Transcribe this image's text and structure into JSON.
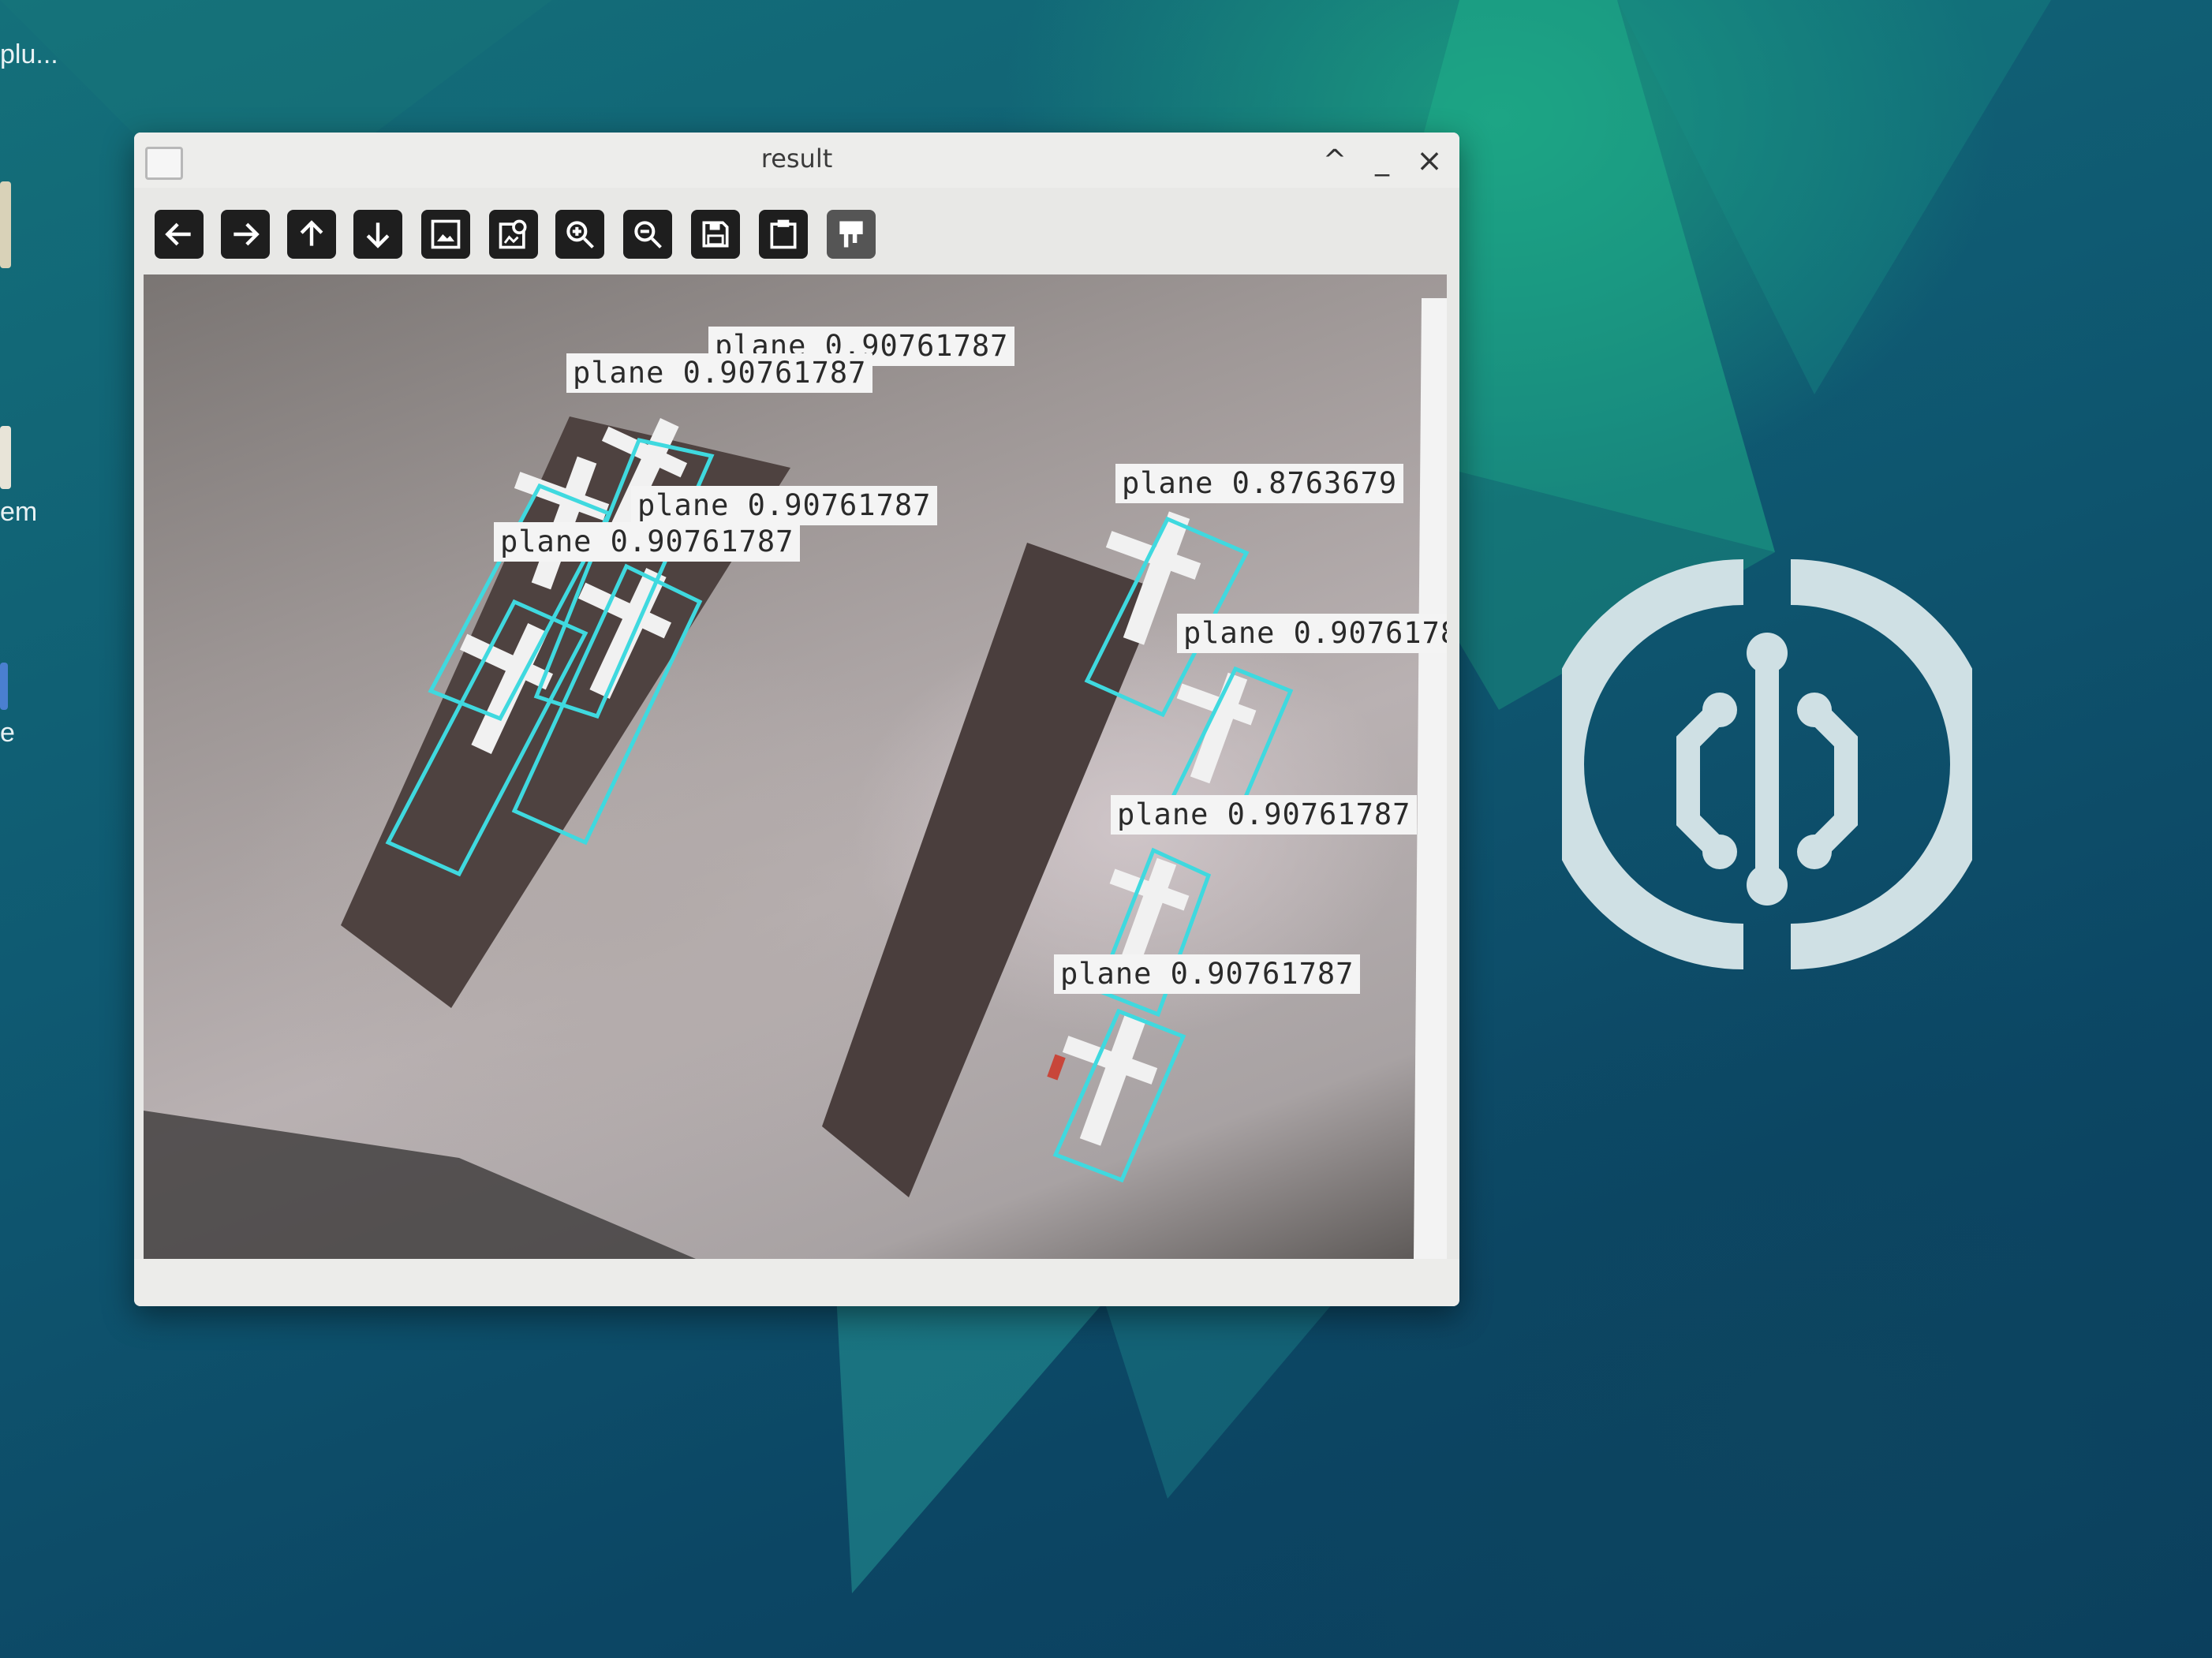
{
  "desktop": {
    "icons": [
      {
        "label": "plu..."
      },
      {
        "label": ""
      },
      {
        "label": "em"
      },
      {
        "label": "e"
      }
    ]
  },
  "window": {
    "title": "result",
    "controls": {
      "maximize": "^",
      "minimize": "_",
      "close": "×"
    },
    "toolbar": [
      {
        "name": "back-arrow-icon"
      },
      {
        "name": "forward-arrow-icon"
      },
      {
        "name": "up-arrow-icon"
      },
      {
        "name": "down-arrow-icon"
      },
      {
        "name": "image-icon"
      },
      {
        "name": "image-search-icon"
      },
      {
        "name": "zoom-in-icon"
      },
      {
        "name": "zoom-out-icon"
      },
      {
        "name": "save-icon"
      },
      {
        "name": "clipboard-icon"
      },
      {
        "name": "paint-icon"
      }
    ]
  },
  "detections": [
    {
      "label": "plane 0.90761787"
    },
    {
      "label": "plane 0.90761787"
    },
    {
      "label": "plane 0.90761787"
    },
    {
      "label": "plane 0.90761787"
    },
    {
      "label": "plane 0.8763679"
    },
    {
      "label": "plane 0.9076178"
    },
    {
      "label": "plane 0.90761787"
    },
    {
      "label": "plane 0.90761787"
    }
  ],
  "colors": {
    "box": "#3fd9df",
    "desktop_teal": "#14707a",
    "logo": "#cfe0e4"
  }
}
